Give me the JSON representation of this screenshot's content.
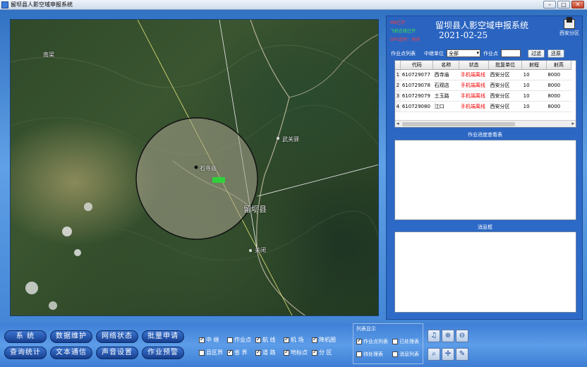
{
  "window": {
    "title": "留坝县人影空域申报系统",
    "min": "–",
    "max": "□",
    "close": "✕"
  },
  "map": {
    "labels": {
      "nanliang": "南梁",
      "wuguansi": "武关驿",
      "shisi": "石寺庙",
      "liuba": "留坝县",
      "guanli": "关闭"
    }
  },
  "panel": {
    "title": "留坝县人影空域申报系统",
    "date": "2021-02-25",
    "status1": "MB已开",
    "status2": "飞机在线已开",
    "status3": "GPS定时：关闭",
    "zone_label": "西安分区",
    "filter": {
      "list_label": "作业点列表",
      "relay_label": "中继单位",
      "relay_value": "全部",
      "point_label": "作业点",
      "filter_btn": "过滤",
      "restore_btn": "还原"
    },
    "table": {
      "headers": [
        "代码",
        "名称",
        "状态",
        "批复单位",
        "射程",
        "射高"
      ],
      "rows": [
        [
          "1",
          "610729077",
          "西寺庙",
          "手机端离线",
          "西安分区",
          "10",
          "8000"
        ],
        [
          "2",
          "610729078",
          "石观店",
          "手机端离线",
          "西安分区",
          "10",
          "8000"
        ],
        [
          "3",
          "610729079",
          "土玉路",
          "手机端离线",
          "西安分区",
          "10",
          "8000"
        ],
        [
          "4",
          "610729080",
          "江口",
          "手机端离线",
          "西安分区",
          "10",
          "8000"
        ]
      ]
    },
    "progress_label": "作业进度查看表",
    "message_label": "消息框"
  },
  "bottom": {
    "buttons": [
      "系 统",
      "数据维护",
      "网络状态",
      "批量申请",
      "查询统计",
      "文本通信",
      "声音设置",
      "作业预警"
    ],
    "layers_row1": [
      {
        "label": "中 继",
        "on": true
      },
      {
        "label": "作业点",
        "on": false
      },
      {
        "label": "航 线",
        "on": true
      },
      {
        "label": "机 场",
        "on": true
      },
      {
        "label": "降机圈",
        "on": true
      }
    ],
    "layers_row2": [
      {
        "label": "县区界",
        "on": false
      },
      {
        "label": "省 界",
        "on": true
      },
      {
        "label": "道 路",
        "on": true
      },
      {
        "label": "地标点",
        "on": true
      },
      {
        "label": "分 区",
        "on": true
      }
    ],
    "list_display": {
      "title": "列表显示",
      "items": [
        {
          "label": "作业点列表",
          "on": true
        },
        {
          "label": "已处理表",
          "on": false
        },
        {
          "label": "待处理表",
          "on": false
        },
        {
          "label": "消息列表",
          "on": false
        }
      ]
    },
    "tools": [
      "♫",
      "⊕",
      "⊖",
      "⌕",
      "✛",
      "✎"
    ]
  }
}
